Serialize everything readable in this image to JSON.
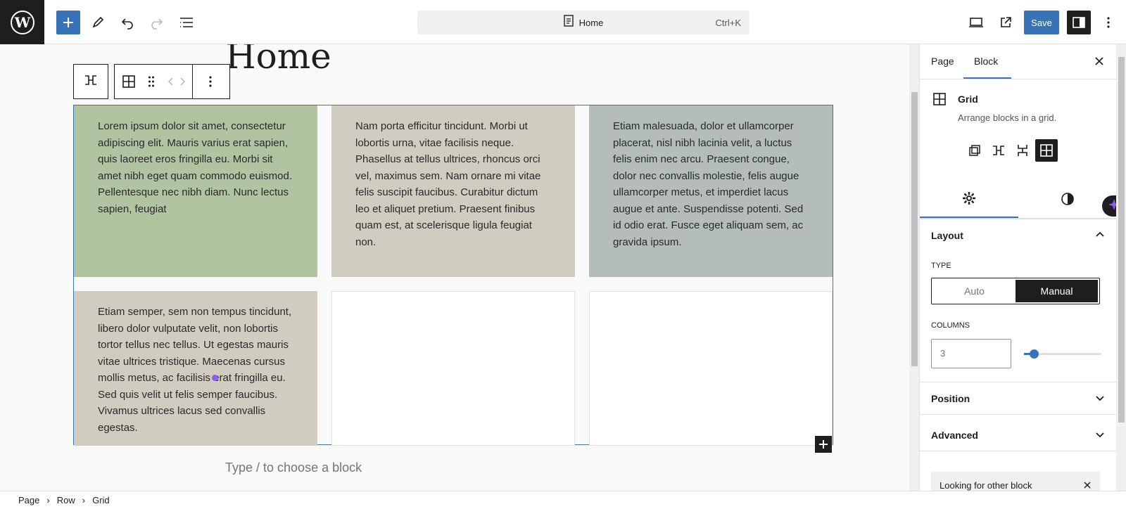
{
  "topbar": {
    "document_title": "Home",
    "shortcut": "Ctrl+K",
    "save_label": "Save"
  },
  "canvas": {
    "page_heading": "Home",
    "placeholder": "Type / to choose a block",
    "grid_cells": [
      {
        "text": "Lorem ipsum dolor sit amet, consectetur adipiscing elit. Mauris varius erat sapien, quis laoreet eros fringilla eu. Morbi sit amet nibh eget quam commodo euismod. Pellentesque nec nibh diam. Nunc lectus sapien, feugiat",
        "bg": "#b0c4a2"
      },
      {
        "text": "Nam porta efficitur tincidunt. Morbi ut lobortis urna, vitae facilisis neque. Phasellus at tellus ultrices, rhoncus orci vel, maximus sem. Nam ornare mi vitae felis suscipit faucibus. Curabitur dictum leo et aliquet pretium. Praesent finibus quam est, at scelerisque ligula feugiat non.",
        "bg": "#d0ccc0"
      },
      {
        "text": "Etiam malesuada, dolor et ullamcorper placerat, nisl nibh lacinia velit, a luctus felis enim nec arcu. Praesent congue, dolor nec convallis molestie, felis augue ullamcorper metus, et imperdiet lacus augue et ante. Suspendisse potenti. Sed id odio erat. Fusce eget aliquam sem, ac gravida ipsum.",
        "bg": "#b4bdbb"
      },
      {
        "text": "Etiam semper, sem non tempus tincidunt, libero dolor vulputate velit, non lobortis tortor tellus nec tellus. Ut egestas mauris vitae ultrices tristique. Maecenas cursus mollis metus, ac facilisis erat fringilla eu. Sed quis velit ut felis semper faucibus. Vivamus ultrices lacus sed convallis egestas.",
        "bg": "#d0ccc0"
      }
    ]
  },
  "sidebar": {
    "tabs": [
      "Page",
      "Block"
    ],
    "block_name": "Grid",
    "block_description": "Arrange blocks in a grid.",
    "layout_title": "Layout",
    "type_label": "TYPE",
    "type_options": [
      "Auto",
      "Manual"
    ],
    "type_selected": "Manual",
    "columns_label": "COLUMNS",
    "columns_value": "3",
    "columns_slider_fraction": 0.15,
    "position_title": "Position",
    "advanced_title": "Advanced",
    "notice_text": "Looking for other block"
  },
  "breadcrumbs": [
    "Page",
    "Row",
    "Grid"
  ],
  "colors": {
    "accent": "#3873b8",
    "dark": "#1e1e1e",
    "ai_accent": "#8b5cf6"
  }
}
